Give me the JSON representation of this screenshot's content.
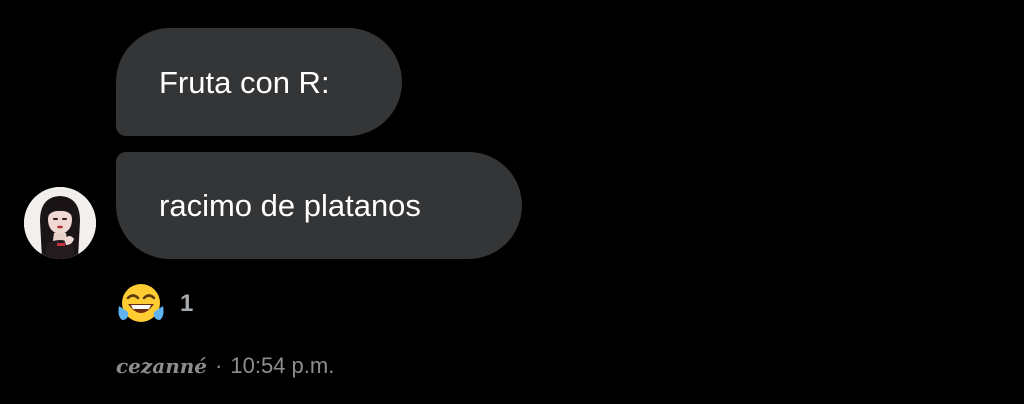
{
  "messages": [
    {
      "text": "Fruta con R:"
    },
    {
      "text": "racimo de platanos"
    }
  ],
  "reaction": {
    "emoji_icon": "face-with-tears-of-joy-icon",
    "count": "1"
  },
  "meta": {
    "sender": "cezanné",
    "separator": "·",
    "time": "10:54 p.m."
  },
  "colors": {
    "background": "#000000",
    "bubble": "#333537",
    "text": "#ffffff",
    "meta_text": "#8b8e91"
  }
}
